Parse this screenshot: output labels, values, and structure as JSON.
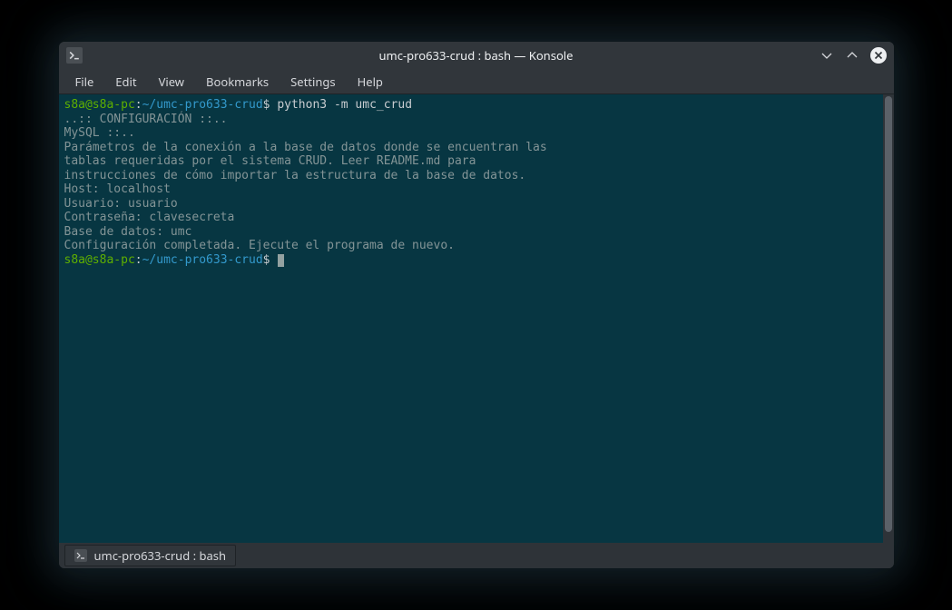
{
  "window": {
    "title": "umc-pro633-crud : bash — Konsole"
  },
  "menubar": {
    "items": [
      "File",
      "Edit",
      "View",
      "Bookmarks",
      "Settings",
      "Help"
    ]
  },
  "prompt1": {
    "user_host": "s8a@s8a-pc",
    "colon": ":",
    "path": "~/umc-pro633-crud",
    "dollar": "$ ",
    "command": "python3 -m umc_crud"
  },
  "output": {
    "l01": "..:: CONFIGURACIÓN ::..",
    "l02": "",
    "l03": "MySQL ::..",
    "l04": "",
    "l05": "Parámetros de la conexión a la base de datos donde se encuentran las",
    "l06": "tablas requeridas por el sistema CRUD. Leer README.md para",
    "l07": "instrucciones de cómo importar la estructura de la base de datos.",
    "l08": "",
    "l09": "Host: localhost",
    "l10": "Usuario: usuario",
    "l11": "Contraseña: clavesecreta",
    "l12": "Base de datos: umc",
    "l13": "",
    "l14": "Configuración completada. Ejecute el programa de nuevo.",
    "l15": ""
  },
  "prompt2": {
    "user_host": "s8a@s8a-pc",
    "colon": ":",
    "path": "~/umc-pro633-crud",
    "dollar": "$ "
  },
  "tab": {
    "label": "umc-pro633-crud : bash"
  }
}
